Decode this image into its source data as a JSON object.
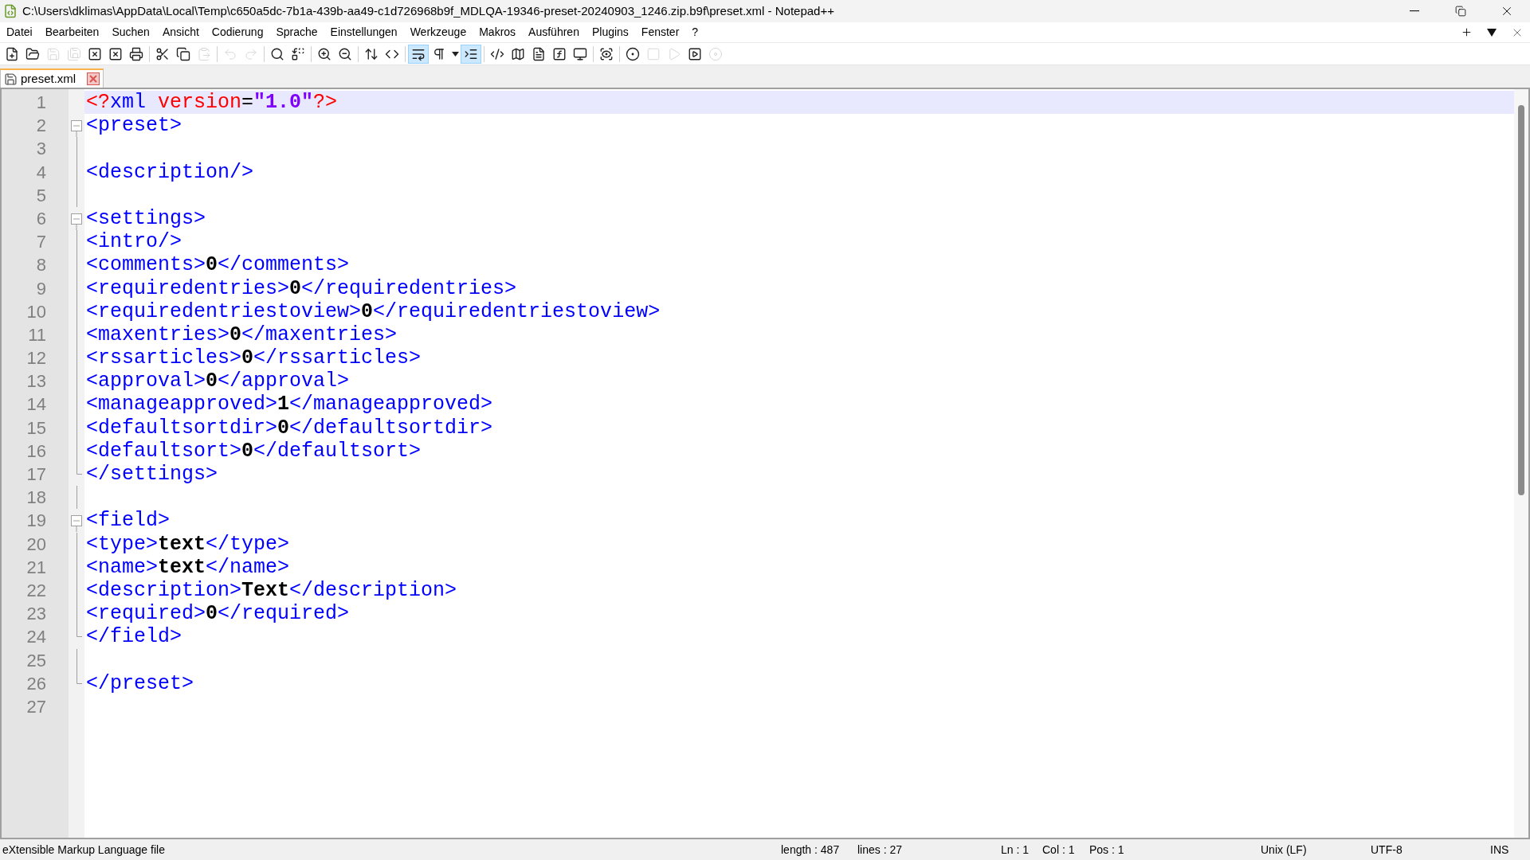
{
  "window": {
    "title": "C:\\Users\\dklimas\\AppData\\Local\\Temp\\c650a5dc-7b1a-439b-aa49-c1d726968b9f_MDLQA-19346-preset-20240903_1246.zip.b9f\\preset.xml - Notepad++"
  },
  "menu": [
    "Datei",
    "Bearbeiten",
    "Suchen",
    "Ansicht",
    "Codierung",
    "Sprache",
    "Einstellungen",
    "Werkzeuge",
    "Makros",
    "Ausführen",
    "Plugins",
    "Fenster",
    "?"
  ],
  "toolbar": [
    {
      "kind": "new",
      "disabled": false,
      "selected": false
    },
    {
      "kind": "open",
      "disabled": false,
      "selected": false
    },
    {
      "kind": "save",
      "disabled": true,
      "selected": false
    },
    {
      "kind": "save-all",
      "disabled": true,
      "selected": false
    },
    {
      "kind": "close",
      "disabled": false,
      "selected": false
    },
    {
      "kind": "close-all",
      "disabled": false,
      "selected": false
    },
    {
      "kind": "print",
      "disabled": false,
      "selected": false
    },
    {
      "kind": "sep"
    },
    {
      "kind": "cut",
      "disabled": false,
      "selected": false
    },
    {
      "kind": "copy",
      "disabled": false,
      "selected": false
    },
    {
      "kind": "paste",
      "disabled": true,
      "selected": false
    },
    {
      "kind": "sep"
    },
    {
      "kind": "undo",
      "disabled": true,
      "selected": false
    },
    {
      "kind": "redo",
      "disabled": true,
      "selected": false
    },
    {
      "kind": "sep"
    },
    {
      "kind": "find",
      "disabled": false,
      "selected": false
    },
    {
      "kind": "replace",
      "disabled": false,
      "selected": false
    },
    {
      "kind": "sep"
    },
    {
      "kind": "zoom-in",
      "disabled": false,
      "selected": false
    },
    {
      "kind": "zoom-out",
      "disabled": false,
      "selected": false
    },
    {
      "kind": "sep"
    },
    {
      "kind": "sync-v",
      "disabled": false,
      "selected": false
    },
    {
      "kind": "sync-h",
      "disabled": false,
      "selected": false
    },
    {
      "kind": "sep"
    },
    {
      "kind": "wrap",
      "disabled": false,
      "selected": true
    },
    {
      "kind": "pilcrow",
      "disabled": false,
      "selected": false
    },
    {
      "kind": "caret",
      "disabled": false,
      "selected": false
    },
    {
      "kind": "indent",
      "disabled": false,
      "selected": true
    },
    {
      "kind": "sep"
    },
    {
      "kind": "code",
      "disabled": false,
      "selected": false
    },
    {
      "kind": "map",
      "disabled": false,
      "selected": false
    },
    {
      "kind": "doc",
      "disabled": false,
      "selected": false
    },
    {
      "kind": "function",
      "disabled": false,
      "selected": false
    },
    {
      "kind": "monitor",
      "disabled": false,
      "selected": false
    },
    {
      "kind": "sep"
    },
    {
      "kind": "focus",
      "disabled": false,
      "selected": false
    },
    {
      "kind": "sep"
    },
    {
      "kind": "record",
      "disabled": false,
      "selected": false
    },
    {
      "kind": "stop",
      "disabled": true,
      "selected": false
    },
    {
      "kind": "play",
      "disabled": true,
      "selected": false
    },
    {
      "kind": "play-box",
      "disabled": false,
      "selected": false
    },
    {
      "kind": "save-macro",
      "disabled": true,
      "selected": false
    }
  ],
  "tabs": [
    {
      "label": "preset.xml",
      "selected": true
    }
  ],
  "editor": {
    "lines": [
      {
        "number": "1",
        "current": true,
        "kind": "plain",
        "tokens": [
          {
            "kind": "attr",
            "text": "<?"
          },
          {
            "kind": "tag",
            "text": "xml"
          },
          {
            "kind": "attr",
            "text": " version"
          },
          {
            "kind": "op",
            "text": "="
          },
          {
            "kind": "string",
            "text": "\"1.0\""
          },
          {
            "kind": "attr",
            "text": "?>"
          }
        ]
      },
      {
        "number": "2",
        "current": false,
        "kind": "fold-start",
        "tokens": [
          {
            "kind": "tag",
            "text": "<preset>"
          }
        ]
      },
      {
        "number": "3",
        "current": false,
        "kind": "fold-body"
      },
      {
        "number": "4",
        "current": false,
        "kind": "fold-body",
        "tokens": [
          {
            "kind": "tag",
            "text": "<description/>"
          }
        ]
      },
      {
        "number": "5",
        "current": false,
        "kind": "fold-body"
      },
      {
        "number": "6",
        "current": false,
        "kind": "fold-start",
        "tokens": [
          {
            "kind": "tag",
            "text": "<settings>"
          }
        ]
      },
      {
        "number": "7",
        "current": false,
        "kind": "fold-body",
        "tokens": [
          {
            "kind": "tag",
            "text": "<intro/>"
          }
        ]
      },
      {
        "number": "8",
        "current": false,
        "kind": "fold-body",
        "tokens": [
          {
            "kind": "tag",
            "text": "<comments>"
          },
          {
            "kind": "value",
            "text": "0"
          },
          {
            "kind": "tag",
            "text": "</comments>"
          }
        ]
      },
      {
        "number": "9",
        "current": false,
        "kind": "fold-body",
        "tokens": [
          {
            "kind": "tag",
            "text": "<requiredentries>"
          },
          {
            "kind": "value",
            "text": "0"
          },
          {
            "kind": "tag",
            "text": "</requiredentries>"
          }
        ]
      },
      {
        "number": "10",
        "current": false,
        "kind": "fold-body",
        "tokens": [
          {
            "kind": "tag",
            "text": "<requiredentriestoview>"
          },
          {
            "kind": "value",
            "text": "0"
          },
          {
            "kind": "tag",
            "text": "</requiredentriestoview>"
          }
        ]
      },
      {
        "number": "11",
        "current": false,
        "kind": "fold-body",
        "tokens": [
          {
            "kind": "tag",
            "text": "<maxentries>"
          },
          {
            "kind": "value",
            "text": "0"
          },
          {
            "kind": "tag",
            "text": "</maxentries>"
          }
        ]
      },
      {
        "number": "12",
        "current": false,
        "kind": "fold-body",
        "tokens": [
          {
            "kind": "tag",
            "text": "<rssarticles>"
          },
          {
            "kind": "value",
            "text": "0"
          },
          {
            "kind": "tag",
            "text": "</rssarticles>"
          }
        ]
      },
      {
        "number": "13",
        "current": false,
        "kind": "fold-body",
        "tokens": [
          {
            "kind": "tag",
            "text": "<approval>"
          },
          {
            "kind": "value",
            "text": "0"
          },
          {
            "kind": "tag",
            "text": "</approval>"
          }
        ]
      },
      {
        "number": "14",
        "current": false,
        "kind": "fold-body",
        "tokens": [
          {
            "kind": "tag",
            "text": "<manageapproved>"
          },
          {
            "kind": "value",
            "text": "1"
          },
          {
            "kind": "tag",
            "text": "</manageapproved>"
          }
        ]
      },
      {
        "number": "15",
        "current": false,
        "kind": "fold-body",
        "tokens": [
          {
            "kind": "tag",
            "text": "<defaultsortdir>"
          },
          {
            "kind": "value",
            "text": "0"
          },
          {
            "kind": "tag",
            "text": "</defaultsortdir>"
          }
        ]
      },
      {
        "number": "16",
        "current": false,
        "kind": "fold-body",
        "tokens": [
          {
            "kind": "tag",
            "text": "<defaultsort>"
          },
          {
            "kind": "value",
            "text": "0"
          },
          {
            "kind": "tag",
            "text": "</defaultsort>"
          }
        ]
      },
      {
        "number": "17",
        "current": false,
        "kind": "fold-end",
        "tokens": [
          {
            "kind": "tag",
            "text": "</settings>"
          }
        ]
      },
      {
        "number": "18",
        "current": false,
        "kind": "fold-body"
      },
      {
        "number": "19",
        "current": false,
        "kind": "fold-start",
        "tokens": [
          {
            "kind": "tag",
            "text": "<field>"
          }
        ]
      },
      {
        "number": "20",
        "current": false,
        "kind": "fold-body",
        "tokens": [
          {
            "kind": "tag",
            "text": "<type>"
          },
          {
            "kind": "value",
            "text": "text"
          },
          {
            "kind": "tag",
            "text": "</type>"
          }
        ]
      },
      {
        "number": "21",
        "current": false,
        "kind": "fold-body",
        "tokens": [
          {
            "kind": "tag",
            "text": "<name>"
          },
          {
            "kind": "value",
            "text": "text"
          },
          {
            "kind": "tag",
            "text": "</name>"
          }
        ]
      },
      {
        "number": "22",
        "current": false,
        "kind": "fold-body",
        "tokens": [
          {
            "kind": "tag",
            "text": "<description>"
          },
          {
            "kind": "value",
            "text": "Text"
          },
          {
            "kind": "tag",
            "text": "</description>"
          }
        ]
      },
      {
        "number": "23",
        "current": false,
        "kind": "fold-body",
        "tokens": [
          {
            "kind": "tag",
            "text": "<required>"
          },
          {
            "kind": "value",
            "text": "0"
          },
          {
            "kind": "tag",
            "text": "</required>"
          }
        ]
      },
      {
        "number": "24",
        "current": false,
        "kind": "fold-end",
        "tokens": [
          {
            "kind": "tag",
            "text": "</field>"
          }
        ]
      },
      {
        "number": "25",
        "current": false,
        "kind": "fold-body"
      },
      {
        "number": "26",
        "current": false,
        "kind": "fold-end",
        "tokens": [
          {
            "kind": "tag",
            "text": "</preset>"
          }
        ]
      },
      {
        "number": "27",
        "current": false,
        "kind": "plain"
      }
    ]
  },
  "status_bar": {
    "file_type": "eXtensible Markup Language file",
    "length": "length : 487",
    "lines": "lines : 27",
    "ln": "Ln : 1",
    "col": "Col : 1",
    "pos": "Pos : 1",
    "eol": "Unix (LF)",
    "encoding": "UTF-8",
    "mode": "INS"
  }
}
